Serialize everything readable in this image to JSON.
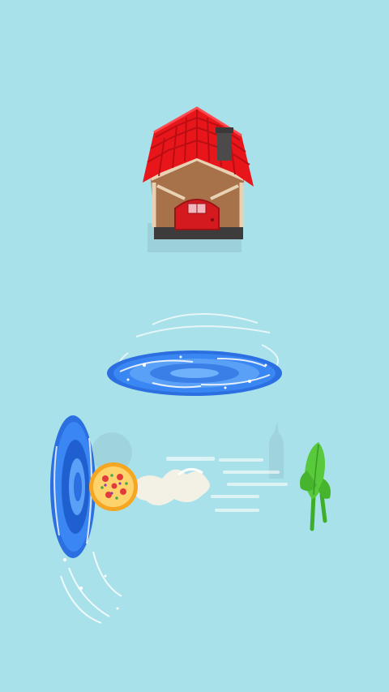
{
  "scene": {
    "background_color": "#a8e1ea",
    "objects": [
      {
        "name": "house",
        "icon": "house-icon",
        "roof_color": "#e8161b",
        "door_color": "#d41a1f",
        "wall_color": "#a7714a"
      },
      {
        "name": "portal-flat",
        "icon": "portal-icon",
        "color": "#3a86f2"
      },
      {
        "name": "portal-vertical",
        "icon": "portal-icon",
        "color": "#3a86f2"
      },
      {
        "name": "pizza",
        "icon": "pizza-icon",
        "crust_color": "#f5a623"
      },
      {
        "name": "creature",
        "icon": "leaf-creature-icon",
        "color": "#57c93b"
      }
    ]
  }
}
